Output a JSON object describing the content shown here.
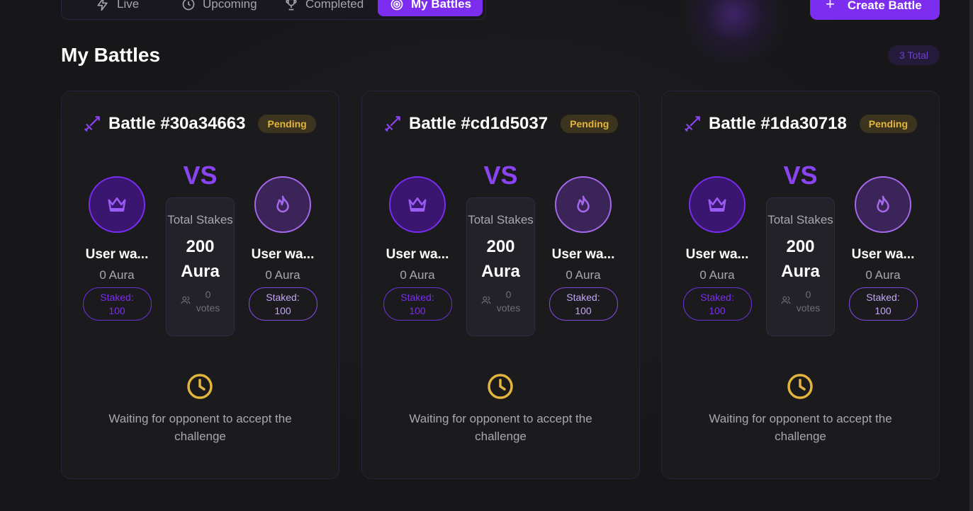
{
  "tabs": [
    {
      "label": "Live",
      "icon": "zap-icon"
    },
    {
      "label": "Upcoming",
      "icon": "clock-icon"
    },
    {
      "label": "Completed",
      "icon": "trophy-icon"
    },
    {
      "label": "My Battles",
      "icon": "target-icon",
      "active": true
    }
  ],
  "create_button": {
    "label": "Create Battle",
    "icon": "plus-icon"
  },
  "section": {
    "title": "My Battles",
    "total_badge": "3 Total"
  },
  "colors": {
    "accent": "#7c2df0",
    "pending": "#e4b53c",
    "background": "#161618"
  },
  "battles": [
    {
      "title": "Battle #30a34663",
      "status": "Pending",
      "vs": "VS",
      "player1": {
        "name": "User wa...",
        "aura": "0 Aura",
        "staked_label": "Staked:",
        "staked_value": "100"
      },
      "player2": {
        "name": "User wa...",
        "aura": "0 Aura",
        "staked_label": "Staked:",
        "staked_value": "100"
      },
      "total_stakes_label": "Total Stakes",
      "total_stakes_value": "200 Aura",
      "votes_count": "0",
      "votes_label": "votes",
      "waiting_text": "Waiting for opponent to accept the challenge"
    },
    {
      "title": "Battle #cd1d5037",
      "status": "Pending",
      "vs": "VS",
      "player1": {
        "name": "User wa...",
        "aura": "0 Aura",
        "staked_label": "Staked:",
        "staked_value": "100"
      },
      "player2": {
        "name": "User wa...",
        "aura": "0 Aura",
        "staked_label": "Staked:",
        "staked_value": "100"
      },
      "total_stakes_label": "Total Stakes",
      "total_stakes_value": "200 Aura",
      "votes_count": "0",
      "votes_label": "votes",
      "waiting_text": "Waiting for opponent to accept the challenge"
    },
    {
      "title": "Battle #1da30718",
      "status": "Pending",
      "vs": "VS",
      "player1": {
        "name": "User wa...",
        "aura": "0 Aura",
        "staked_label": "Staked:",
        "staked_value": "100"
      },
      "player2": {
        "name": "User wa...",
        "aura": "0 Aura",
        "staked_label": "Staked:",
        "staked_value": "100"
      },
      "total_stakes_label": "Total Stakes",
      "total_stakes_value": "200 Aura",
      "votes_count": "0",
      "votes_label": "votes",
      "waiting_text": "Waiting for opponent to accept the challenge"
    }
  ]
}
